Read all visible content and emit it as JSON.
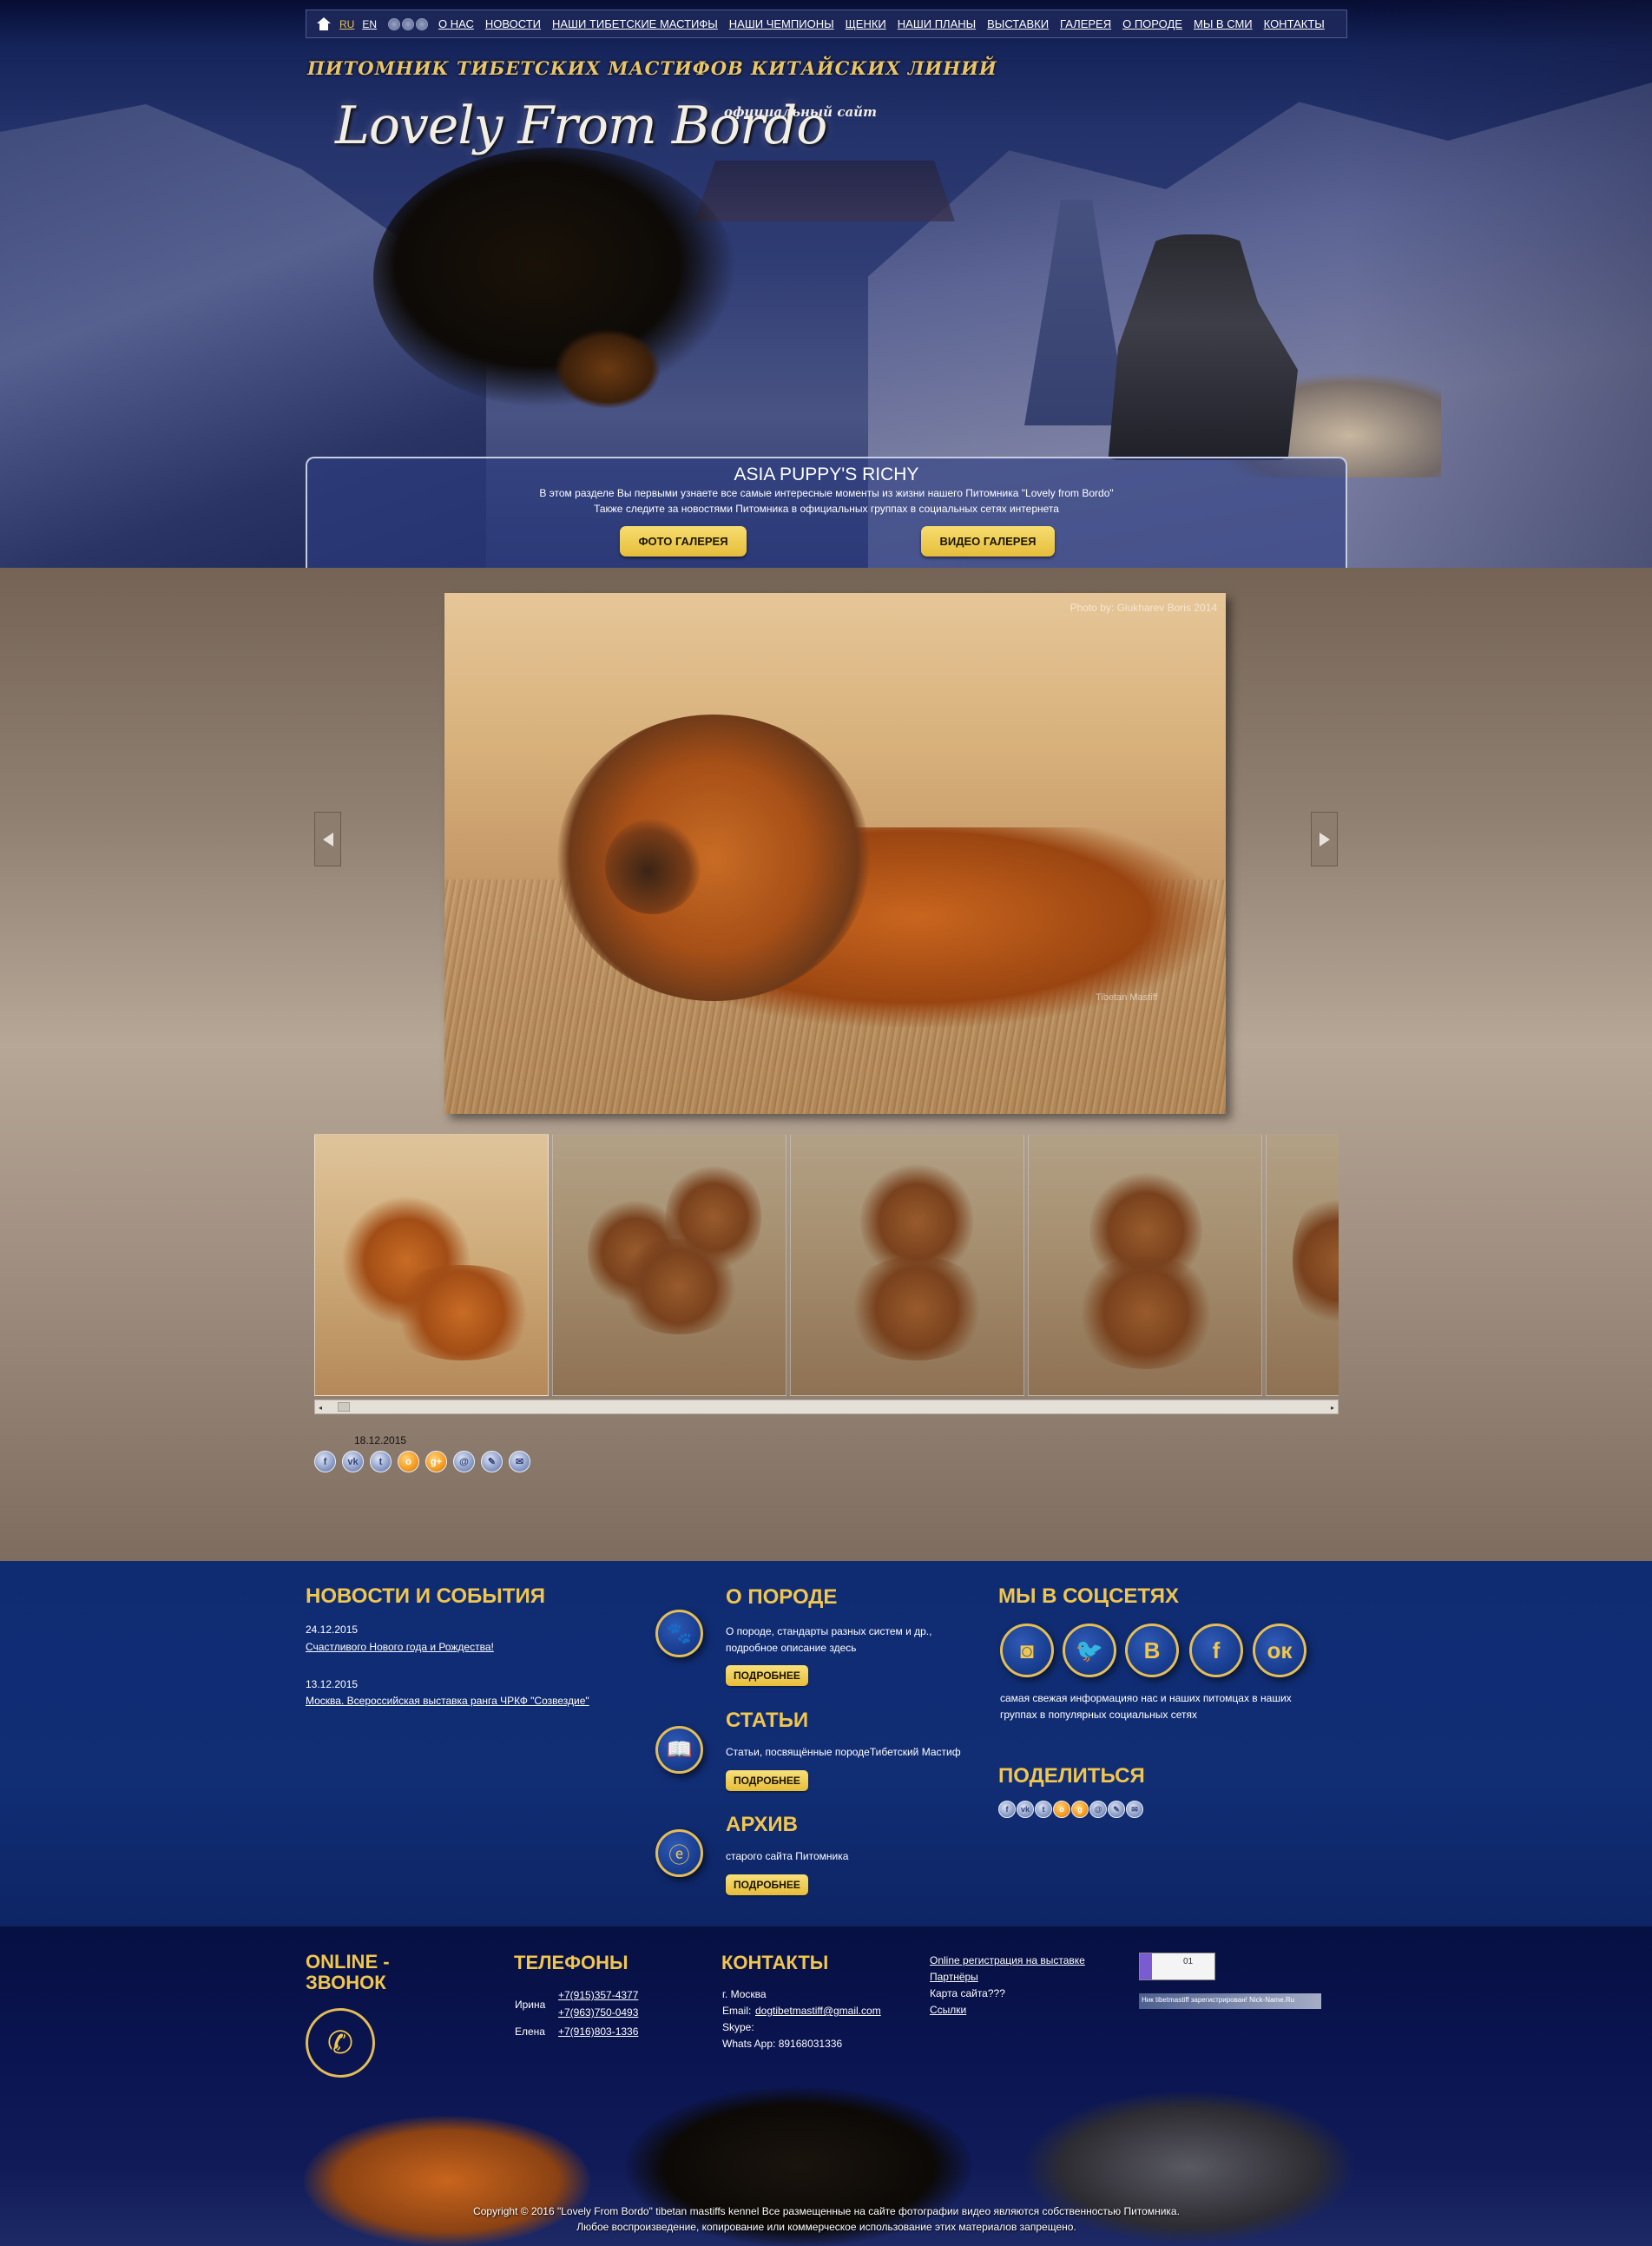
{
  "topnav": {
    "langs": [
      "RU",
      "EN"
    ],
    "items": [
      "О НАС",
      "НОВОСТИ",
      "НАШИ ТИБЕТСКИЕ МАСТИФЫ",
      "НАШИ ЧЕМПИОНЫ",
      "ЩЕНКИ",
      "НАШИ ПЛАНЫ",
      "ВЫСТАВКИ",
      "ГАЛЕРЕЯ",
      "О ПОРОДЕ",
      "МЫ В СМИ",
      "КОНТАКТЫ"
    ]
  },
  "header": {
    "tagline": "ПИТОМНИК ТИБЕТСКИХ МАСТИФОВ КИТАЙСКИХ ЛИНИЙ",
    "logo": "Lovely From Bordo",
    "official": "официальный сайт"
  },
  "gallery_box": {
    "title": "ASIA PUPPY'S RICHY",
    "line1": "В этом разделе Вы первыми узнаете все самые интересные моменты из жизни нашего Питомника \"Lovely from Bordo\"",
    "line2": "Также следите за новостями Питомника в официальных группах в социальных сетях интернета",
    "photo_btn": "ФОТО ГАЛЕРЕЯ",
    "video_btn": "ВИДЕО ГАЛЕРЕЯ"
  },
  "viewer": {
    "credit": "Photo by: Glukharev Boris 2014",
    "watermark": "Tibetan Mastiff",
    "date": "18.12.2015"
  },
  "share_icons": [
    "facebook-icon",
    "vk-icon",
    "twitter-icon",
    "odnoklassniki-icon",
    "google-plus-icon",
    "mail-ru-icon",
    "livejournal-icon",
    "email-icon"
  ],
  "news": {
    "heading": "НОВОСТИ И СОБЫТИЯ",
    "items": [
      {
        "date": "24.12.2015",
        "title": "Счастливого Нового года и Рождества!"
      },
      {
        "date": "13.12.2015",
        "title": "Москва. Всероссийская выставка ранга ЧРКФ \"Созвездие\""
      }
    ]
  },
  "blocks": {
    "breed": {
      "title": "О ПОРОДЕ",
      "text1": "О породе, стандарты разных систем и др.,",
      "text2": "подробное описание здесь",
      "btn": "ПОДРОБНЕЕ"
    },
    "articles": {
      "title": "СТАТЬИ",
      "text1": "Статьи, посвящённые породеТибетский Мастиф",
      "btn": "ПОДРОБНЕЕ"
    },
    "archive": {
      "title": "АРХИВ",
      "text1": "старого сайта Питомника",
      "btn": "ПОДРОБНЕЕ"
    }
  },
  "social": {
    "heading": "МЫ В СОЦСЕТЯХ",
    "icons": [
      "instagram-icon",
      "twitter-icon",
      "vk-icon",
      "facebook-icon",
      "odnoklassniki-icon"
    ],
    "text1": "самая свежая информацияо нас и наших питомцах в наших",
    "text2": "группах в популярных социальных сетях",
    "share_heading": "ПОДЕЛИТЬСЯ"
  },
  "footer": {
    "call_heading1": "ONLINE -",
    "call_heading2": "ЗВОНОК",
    "phones_heading": "ТЕЛЕФОНЫ",
    "phones": [
      {
        "name": "Ирина",
        "number": "+7(915)357-4377"
      },
      {
        "name": "",
        "number": "+7(963)750-0493"
      },
      {
        "name": "Елена",
        "number": "+7(916)803-1336"
      }
    ],
    "contacts_heading": "КОНТАКТЫ",
    "city": "г. Москва",
    "email_label": "Email:",
    "email": "dogtibetmastiff@gmail.com",
    "skype": "Skype:",
    "whatsapp": "Whats App: 89168031336",
    "links": [
      "Online регистрация на выставке",
      "Партнёры",
      "Карта сайта???",
      "Ссылки"
    ],
    "nick_badge": "Ник tibetmastiff зарегистрирован! Nick-Name.Ru",
    "counter": "01",
    "copyright1": "Copyright © 2016 \"Lovely From Bordo\" tibetan mastiffs kennel Все размещенные на сайте фотографии видео являются собственностью Питомника.",
    "copyright2": "Любое воспроизведение, копирование или коммерческое использование этих материалов запрещено."
  },
  "colors": {
    "accent": "#f0c64e",
    "blue_band": "#112d74",
    "dark_band": "#0a1450",
    "gallery_bg": "#b7a797"
  }
}
